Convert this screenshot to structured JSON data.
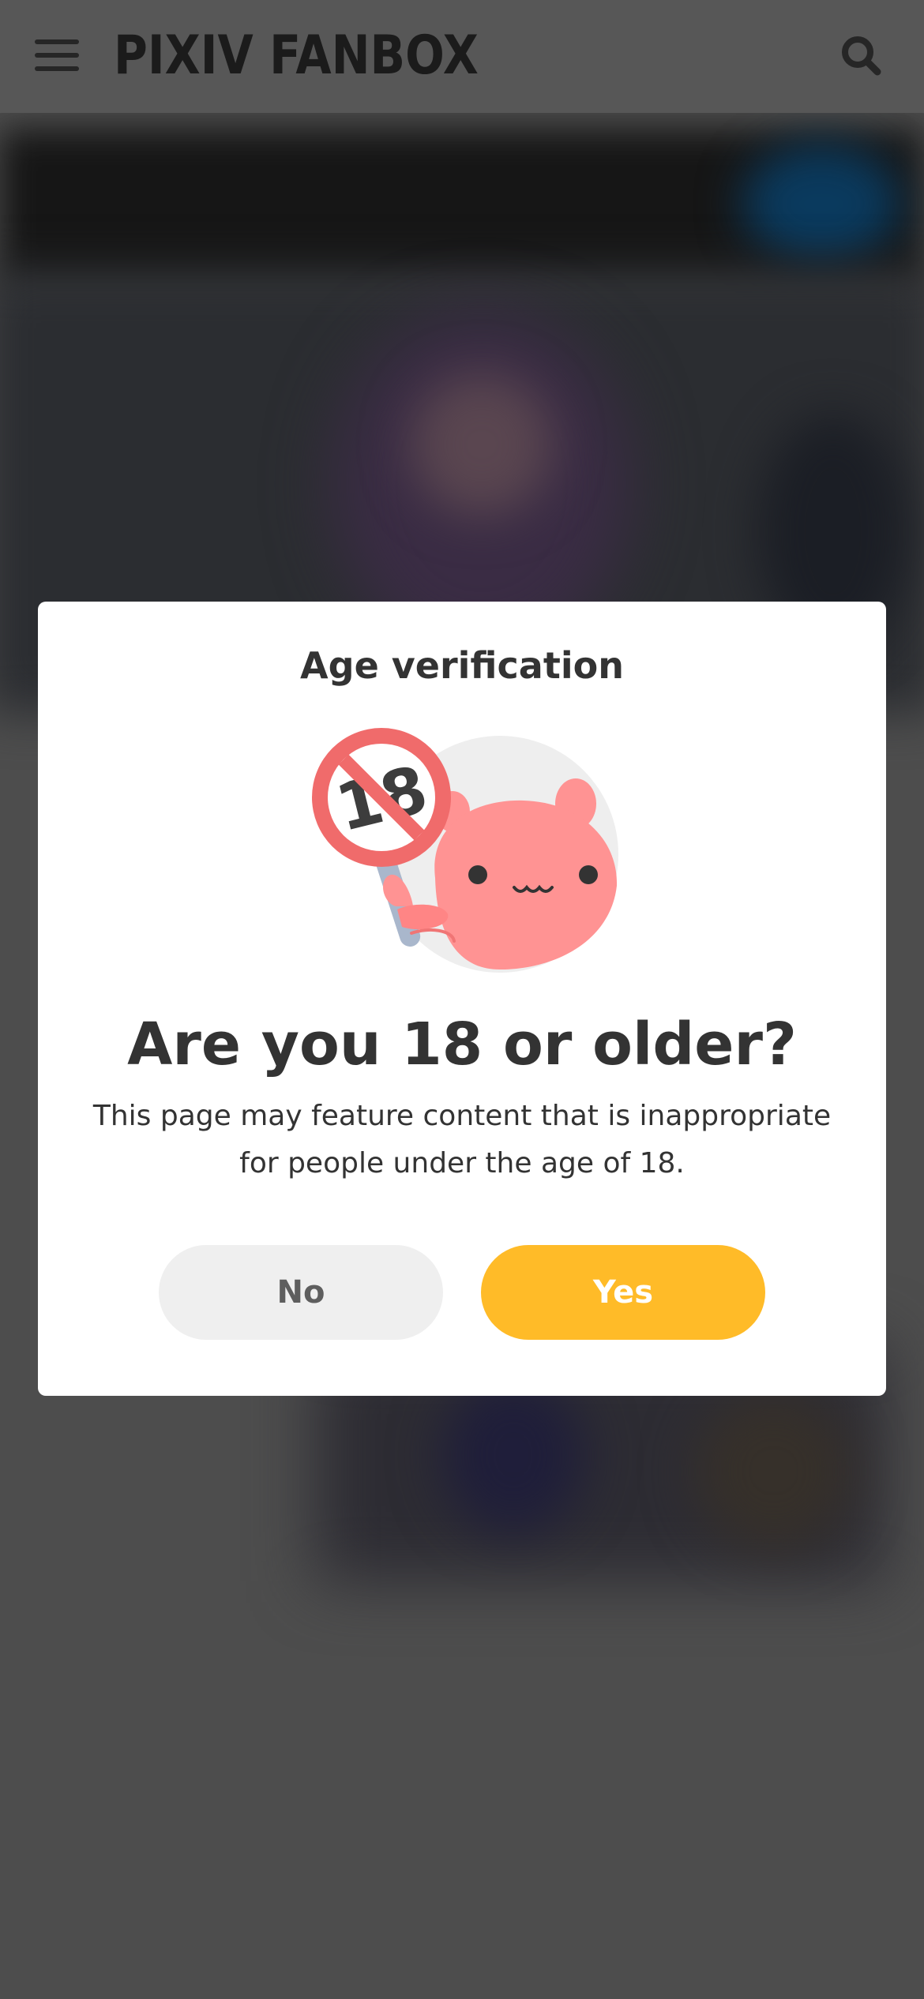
{
  "header": {
    "logo": "PIXIV FANBOX",
    "menu_icon": "hamburger-menu-icon",
    "search_icon": "search-icon"
  },
  "modal": {
    "heading": "Age verification",
    "image_icon": "no-under-18-mascot-icon",
    "question": "Are you 18 or older?",
    "body": "This page may feature content that is inappropriate for people under the age of 18.",
    "no_label": "No",
    "yes_label": "Yes"
  },
  "colors": {
    "overlay": "#4d4d4d",
    "header": "#575757",
    "modal_bg": "#ffffff",
    "text": "#333333",
    "yes_button": "#ffbb28",
    "no_button": "#efefef",
    "mascot_pink": "#ff8f8f",
    "sign_red": "#f06b6b"
  }
}
